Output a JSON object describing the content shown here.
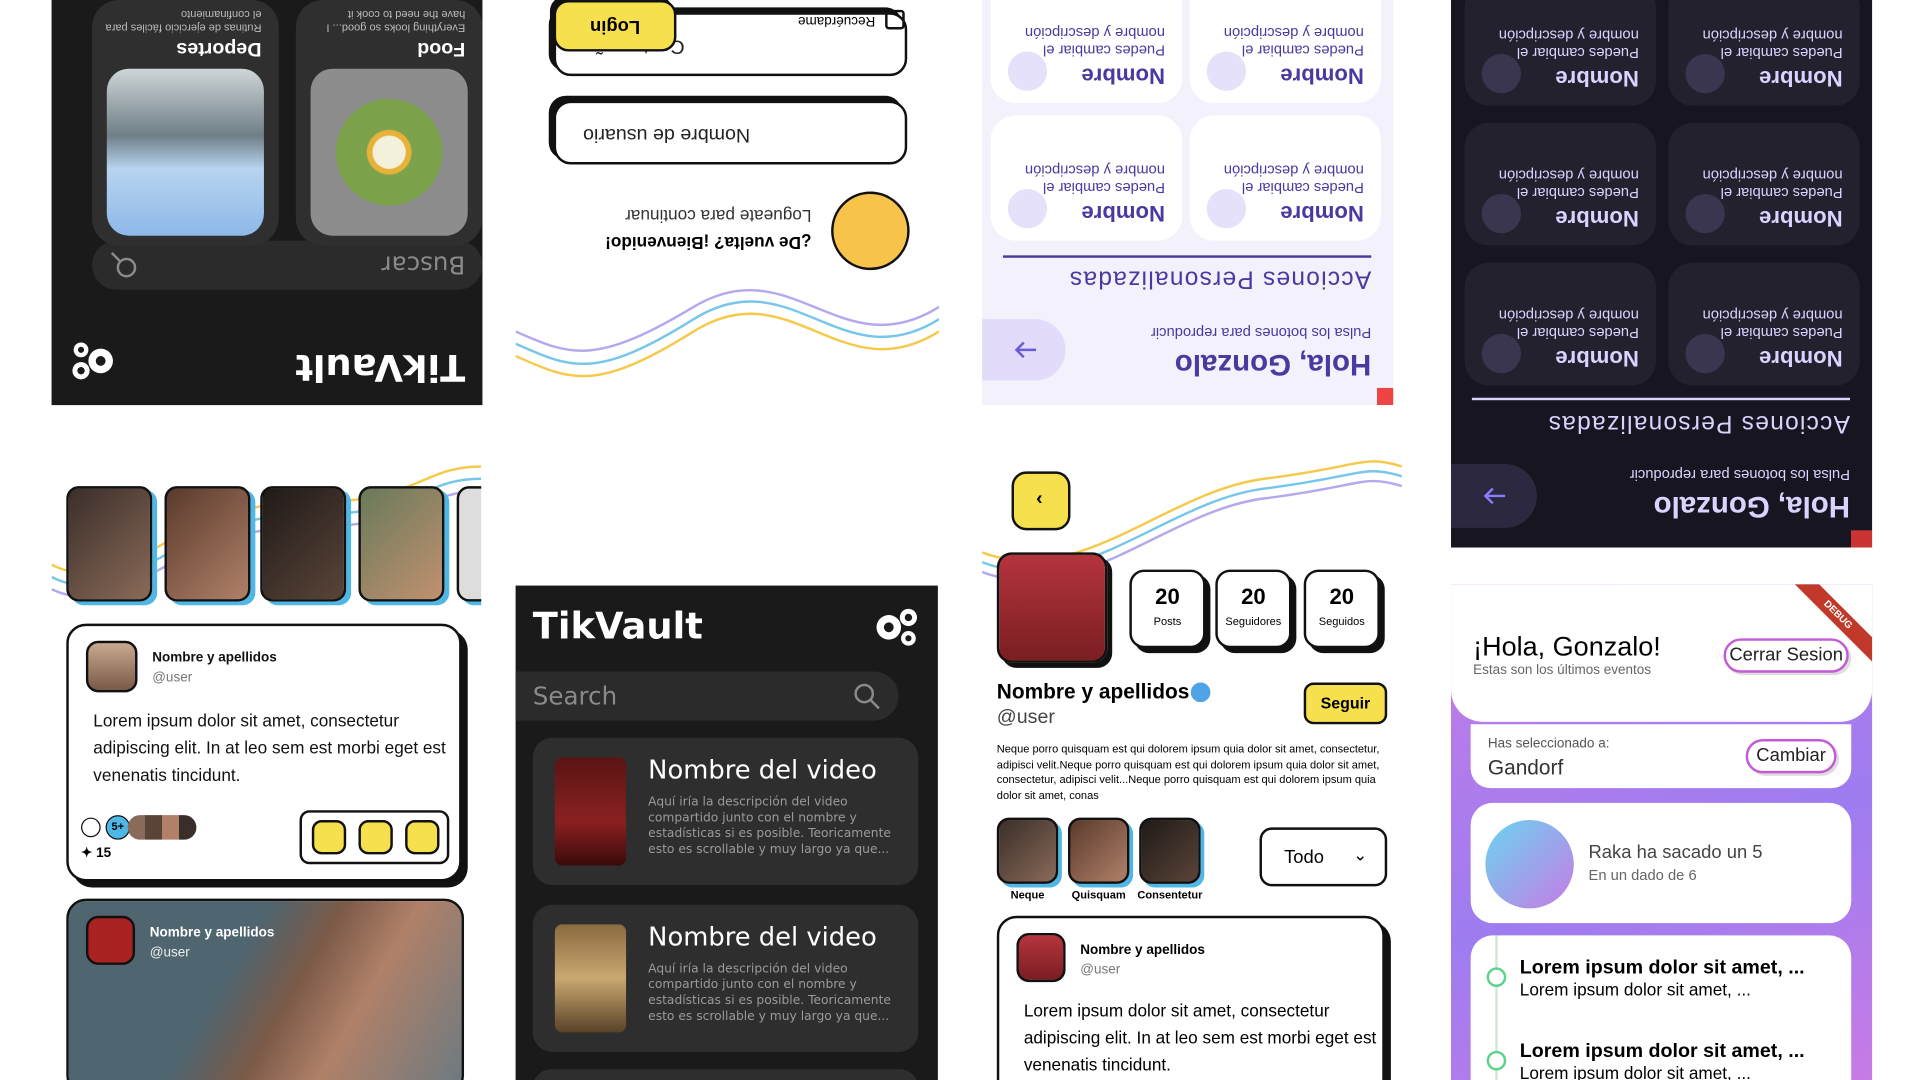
{
  "brand": "TikVault",
  "p1": {
    "search_placeholder": "Buscar",
    "categories": [
      {
        "name": "Deportes",
        "desc": "Rutinas de ejercicio fáciles para el confinamiento"
      },
      {
        "name": "Food",
        "desc": "Everything looks so good... I have the need to cook it"
      }
    ]
  },
  "login": {
    "welcome": "¿De vuelta? ¡Bienvenido!",
    "subtitle": "Logueate para continuar",
    "username_placeholder": "Nombre de usuario",
    "password_placeholder": "Contraseña",
    "remember_label": "Recuérdame",
    "login_button": "Login"
  },
  "actions": {
    "greeting": "Hola, Gonzalo",
    "instruction": "Pulsa los botones para reproducir",
    "section_title": "Acciones Personalizadas",
    "card_title": "Nombre",
    "card_desc": "Puedes cambiar el nombre y descripción"
  },
  "feed": {
    "post_name": "Nombre y apellidos",
    "post_user": "@user",
    "post_text": "Lorem ipsum dolor sit amet, consectetur adipiscing elit. In at leo sem est morbi eget est venenatis tincidunt.",
    "reaction_badge": "5+",
    "score": "15",
    "second_name": "Nombre y apellidos",
    "second_user": "@user"
  },
  "videos": {
    "search_placeholder": "Search",
    "items": [
      {
        "title": "Nombre del video",
        "desc": "Aquí iría la descripción del video compartido junto con el nombre y estadísticas si es posible. Teoricamente esto es scrollable y muy largo ya que..."
      },
      {
        "title": "Nombre del video",
        "desc": "Aquí iría la descripción del video compartido junto con el nombre y estadísticas si es posible. Teoricamente esto es scrollable y muy largo ya que..."
      }
    ]
  },
  "profile": {
    "stats": [
      {
        "value": "20",
        "label": "Posts"
      },
      {
        "value": "20",
        "label": "Seguidores"
      },
      {
        "value": "20",
        "label": "Seguidos"
      }
    ],
    "name": "Nombre y apellidos",
    "user": "@user",
    "follow_button": "Seguir",
    "bio": "Neque porro quisquam est qui dolorem ipsum quia dolor sit amet, consectetur, adipisci velit.Neque porro quisquam est qui dolorem ipsum quia dolor sit amet, consectetur, adipisci velit...Neque porro quisquam est qui dolorem ipsum quia dolor sit amet, conas",
    "highlights": [
      "Neque",
      "Quisquam",
      "Consentetur"
    ],
    "filter_value": "Todo",
    "post_name": "Nombre y apellidos",
    "post_user": "@user",
    "post_text": "Lorem ipsum dolor sit amet, consectetur adipiscing elit. In at leo sem est morbi eget est venenatis tincidunt."
  },
  "events": {
    "greeting": "¡Hola, Gonzalo!",
    "subtitle": "Estas son los últimos eventos",
    "logout_button": "Cerrar Sesion",
    "debug_banner": "DEBUG",
    "selected_label": "Has seleccionado a:",
    "selected_name": "Gandorf",
    "change_button": "Cambiar",
    "dice_title": "Raka ha sacado un 5",
    "dice_sub": "En un dado de 6",
    "list": [
      {
        "title": "Lorem ipsum dolor sit amet, ...",
        "sub": "Lorem ipsum dolor sit amet, ..."
      },
      {
        "title": "Lorem ipsum dolor sit amet, ...",
        "sub": "Lorem ipsum dolor sit amet, ..."
      }
    ]
  },
  "colors": {
    "yellow": "#f7e04d",
    "dark": "#1a1a1a",
    "purple": "#4a3aa0",
    "accent_blue": "#4fb7e6"
  }
}
